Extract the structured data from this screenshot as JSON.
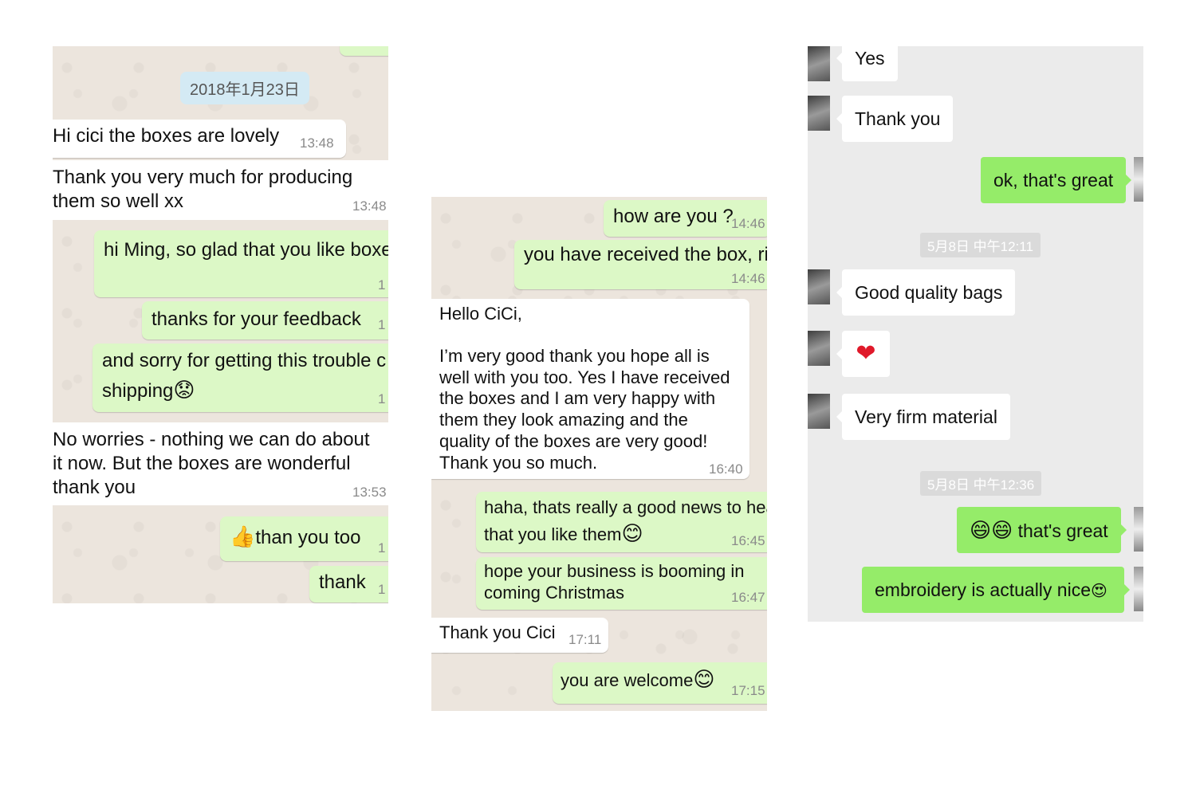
{
  "left": {
    "date": "2018年1月23日",
    "m1": {
      "text": "Hi cici the boxes are lovely",
      "time": "13:48"
    },
    "m2": {
      "line1": "Thank you very much for producing",
      "line2": "them so well xx",
      "time": "13:48"
    },
    "m3": {
      "text": "hi Ming, so glad that you like boxe",
      "time": "1"
    },
    "m4": {
      "text": "thanks for your feedback",
      "time": "1"
    },
    "m5": {
      "line1": "and sorry for getting this trouble c",
      "line2": "shipping",
      "emoji": "😟",
      "time": "1"
    },
    "m6": {
      "line1": "No worries - nothing we can do about",
      "line2": "it now. But the boxes are wonderful",
      "line3": "thank you",
      "time": "13:53"
    },
    "m7": {
      "emoji": "👍",
      "text": "than you too",
      "time": "1"
    },
    "m8": {
      "text": "thank",
      "time": "1"
    }
  },
  "middle": {
    "m1": {
      "text": "how are you ?",
      "time": "14:46"
    },
    "m2": {
      "text": "you have received the box, righ",
      "time": "14:46"
    },
    "m3": {
      "greeting": "Hello CiCi,",
      "l1": "I’m very good thank you hope all is",
      "l2": "well with you too. Yes I have received",
      "l3": "the boxes and I am very happy with",
      "l4": "them they look amazing and the",
      "l5": "quality of the boxes are very good!",
      "l6": "Thank you so much.",
      "time": "16:40"
    },
    "m4": {
      "line1": "haha, thats really a good news to hea",
      "line2": "that you like them",
      "emoji": "😊",
      "time": "16:45"
    },
    "m5": {
      "line1": "hope your business is booming in",
      "line2": "coming Christmas",
      "time": "16:47"
    },
    "m6": {
      "text": "Thank you Cici",
      "time": "17:11"
    },
    "m7": {
      "text": "you are welcome",
      "emoji": "😊",
      "time": "17:15"
    }
  },
  "right": {
    "m1": "Yes",
    "m2": "Thank you",
    "m3": "ok, that's great",
    "stamp1": "5月8日 中午12:11",
    "m4": "Good quality bags",
    "m5_icon": "heart",
    "m6": "Very firm material",
    "stamp2": "5月8日 中午12:36",
    "m7": {
      "emoji": "😄😄",
      "text": "that's great"
    },
    "m8": {
      "text": "embroidery is actually nice",
      "emoji": "😍"
    }
  }
}
